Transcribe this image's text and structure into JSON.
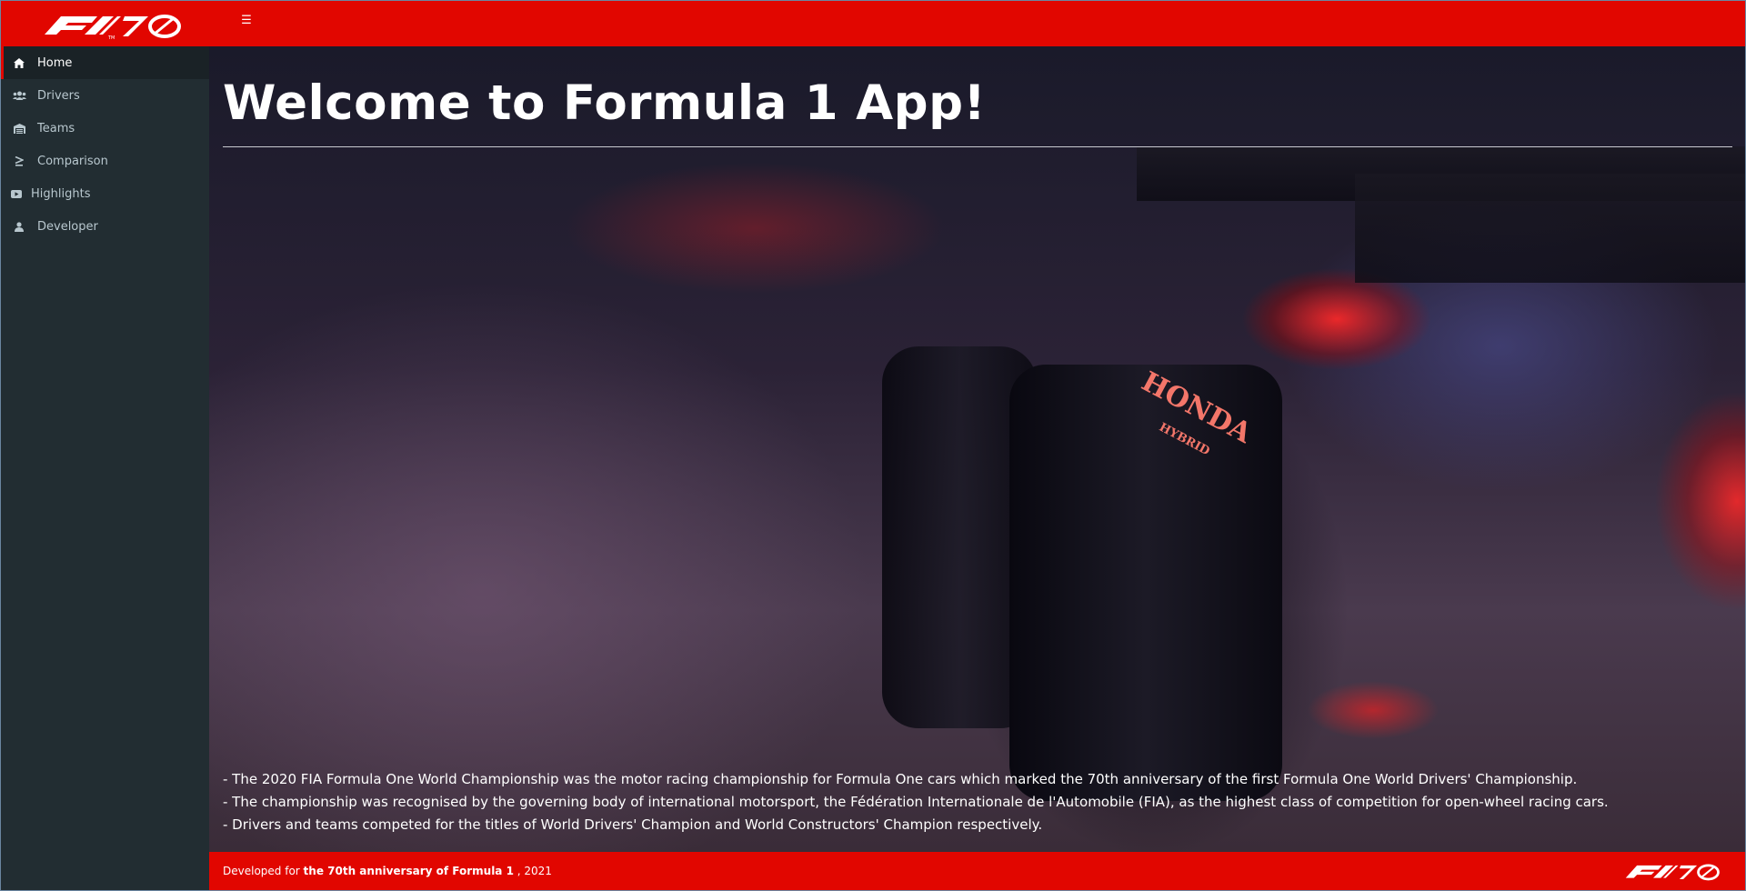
{
  "header": {
    "logo_alt": "F1 70",
    "menu_icon": "hamburger-icon"
  },
  "sidebar": {
    "items": [
      {
        "label": "Home",
        "icon": "home-icon",
        "active": true
      },
      {
        "label": "Drivers",
        "icon": "users-icon",
        "active": false
      },
      {
        "label": "Teams",
        "icon": "garage-icon",
        "active": false
      },
      {
        "label": "Comparison",
        "icon": "greater-equal-icon",
        "active": false
      },
      {
        "label": "Highlights",
        "icon": "video-icon",
        "active": false
      },
      {
        "label": "Developer",
        "icon": "user-icon",
        "active": false
      }
    ]
  },
  "main": {
    "title": "Welcome to Formula 1 App!",
    "facts": [
      "- The 2020 FIA Formula One World Championship was the motor racing championship for Formula One cars which marked the 70th anniversary of the first Formula One World Drivers' Championship.",
      "- The championship was recognised by the governing body of international motorsport, the Fédération Internationale de l'Automobile (FIA), as the highest class of competition for open-wheel racing cars.",
      "- Drivers and teams competed for the titles of World Drivers' Champion and World Constructors' Champion respectively."
    ],
    "background_text": {
      "sponsor": "HONDA",
      "sponsor_sub": "HYBRID"
    }
  },
  "footer": {
    "prefix": "Developed for",
    "bold": "the 70th anniversary of Formula 1",
    "suffix": ", 2021"
  },
  "colors": {
    "brand_red": "#e10600",
    "sidebar_bg": "#222d32",
    "sidebar_active_bg": "#1a2226",
    "sidebar_text": "#b8c7ce"
  }
}
